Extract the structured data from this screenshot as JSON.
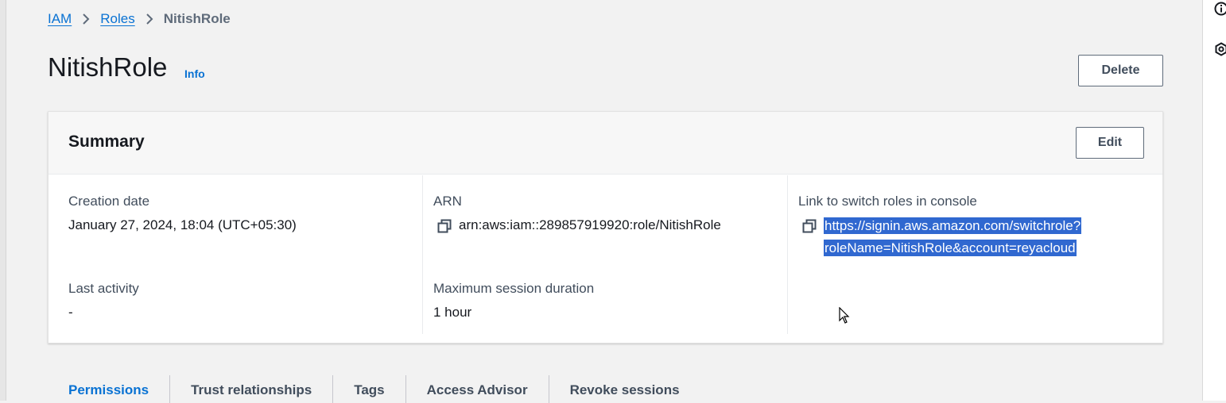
{
  "breadcrumb": {
    "items": [
      "IAM",
      "Roles"
    ],
    "current": "NitishRole"
  },
  "page": {
    "title": "NitishRole",
    "info_label": "Info",
    "delete_label": "Delete"
  },
  "summary": {
    "title": "Summary",
    "edit_label": "Edit",
    "creation_date_label": "Creation date",
    "creation_date_value": "January 27, 2024, 18:04 (UTC+05:30)",
    "arn_label": "ARN",
    "arn_value": "arn:aws:iam::289857919920:role/NitishRole",
    "switch_link_label": "Link to switch roles in console",
    "switch_link_line1": "https://signin.aws.amazon.com/switchrole?",
    "switch_link_line2": "roleName=NitishRole&account=reyacloud",
    "last_activity_label": "Last activity",
    "last_activity_value": "-",
    "max_session_label": "Maximum session duration",
    "max_session_value": "1 hour"
  },
  "tabs": [
    {
      "label": "Permissions",
      "active": true
    },
    {
      "label": "Trust relationships",
      "active": false
    },
    {
      "label": "Tags",
      "active": false
    },
    {
      "label": "Access Advisor",
      "active": false
    },
    {
      "label": "Revoke sessions",
      "active": false
    }
  ],
  "icons": {
    "breadcrumb_separator": "chevron-right-icon",
    "copy": "copy-icon",
    "rail_top": "info-icon",
    "rail_second": "settings-icon"
  },
  "colors": {
    "link": "#0972d3",
    "selection": "#3068d0",
    "background": "#f2f2f2"
  }
}
